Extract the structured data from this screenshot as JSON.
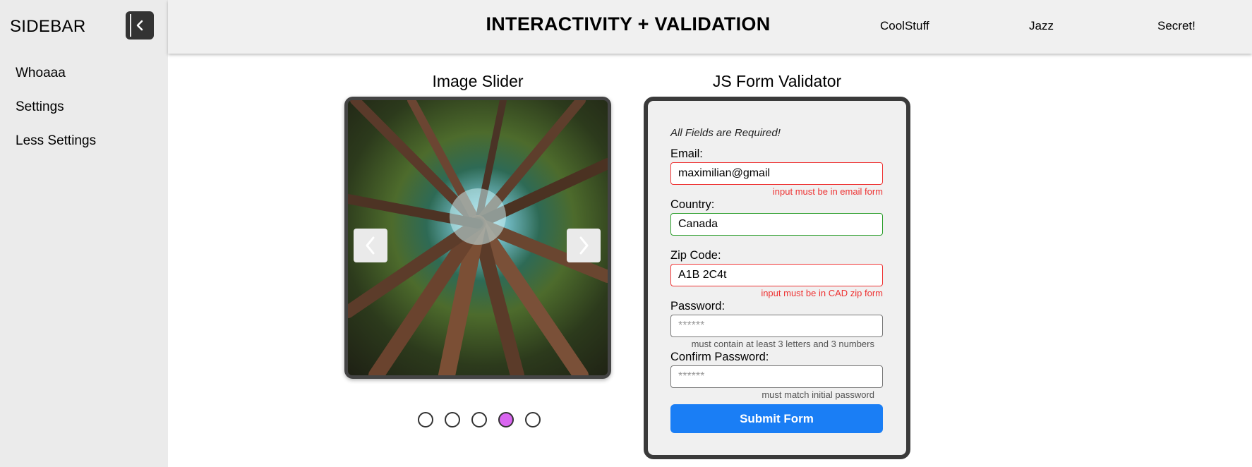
{
  "sidebar": {
    "title": "SIDEBAR",
    "items": [
      {
        "label": "Whoaaa"
      },
      {
        "label": "Settings"
      },
      {
        "label": "Less Settings"
      }
    ]
  },
  "header": {
    "title": "INTERACTIVITY + VALIDATION",
    "links": [
      {
        "label": "CoolStuff"
      },
      {
        "label": "Jazz"
      },
      {
        "label": "Secret!"
      }
    ]
  },
  "slider": {
    "title": "Image Slider",
    "slide_count": 5,
    "active_index": 3,
    "active_color": "#d966f0"
  },
  "form": {
    "title": "JS Form Validator",
    "note": "All Fields are Required!",
    "email": {
      "label": "Email:",
      "value": "maximilian@gmail",
      "state": "error",
      "hint": "input must be in email form"
    },
    "country": {
      "label": "Country:",
      "value": "Canada",
      "state": "valid"
    },
    "zip": {
      "label": "Zip Code:",
      "value": "A1B 2C4t",
      "state": "error",
      "hint": "input must be in CAD zip form"
    },
    "password": {
      "label": "Password:",
      "placeholder": "******",
      "hint": "must contain at least 3 letters and 3 numbers"
    },
    "confirm": {
      "label": "Confirm Password:",
      "placeholder": "******",
      "hint": "must match initial password"
    },
    "submit_label": "Submit Form",
    "colors": {
      "error": "#ee3333",
      "valid": "#2a9d2a",
      "submit": "#1a7ef5"
    }
  }
}
